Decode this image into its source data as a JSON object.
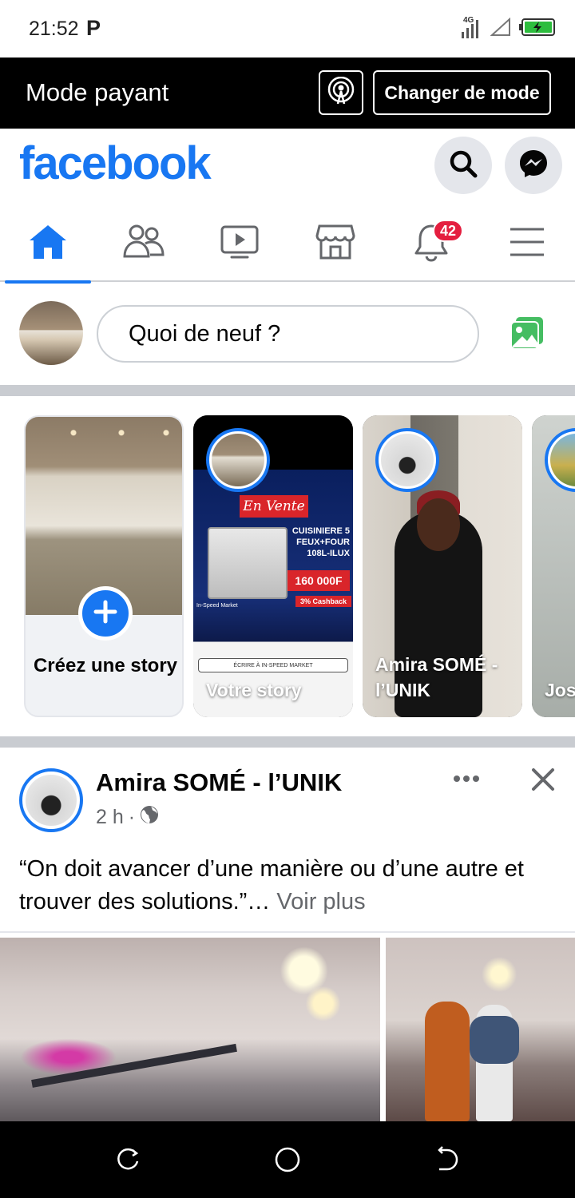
{
  "status_bar": {
    "time": "21:52",
    "carrier_glyph": "P",
    "network": "4G",
    "icons": [
      "signal-icon",
      "wifi-icon",
      "battery-charging-icon"
    ]
  },
  "mode_bar": {
    "title": "Mode payant",
    "change_mode_label": "Changer de mode",
    "icon": "broadcast-icon"
  },
  "header": {
    "logo": "facebook",
    "brand_color": "#1877f2",
    "icons": [
      "search-icon",
      "messenger-icon"
    ]
  },
  "nav": {
    "tabs": [
      {
        "name": "home",
        "icon": "home-icon",
        "active": true
      },
      {
        "name": "friends",
        "icon": "friends-icon",
        "active": false
      },
      {
        "name": "watch",
        "icon": "video-icon",
        "active": false
      },
      {
        "name": "marketplace",
        "icon": "marketplace-icon",
        "active": false
      },
      {
        "name": "notifications",
        "icon": "bell-icon",
        "active": false,
        "badge": "42"
      },
      {
        "name": "menu",
        "icon": "menu-icon",
        "active": false
      }
    ]
  },
  "composer": {
    "placeholder": "Quoi de neuf ?",
    "photo_icon": "photo-icon"
  },
  "stories": {
    "create_label": "Créez une story",
    "items": [
      {
        "label": "Votre story"
      },
      {
        "label": "Amira SOMÉ - l’UNIK"
      },
      {
        "label": "Jos"
      }
    ],
    "ad": {
      "headline": "En Vente",
      "product": "CUISINIERE 5 FEUX+FOUR 108L-ILUX",
      "price": "160 000F",
      "cashback": "3% Cashback",
      "seller": "In-Speed Market",
      "cta": "ÉCRIRE À IN-SPEED MARKET"
    }
  },
  "post": {
    "author": "Amira SOMÉ - l’UNIK",
    "time": "2 h",
    "separator": "·",
    "privacy_icon": "globe-icon",
    "text": "“On doit avancer d’une manière ou d’une autre et trouver des solutions.”…",
    "see_more": "Voir plus"
  },
  "android_nav": {
    "icons": [
      "recent-apps-icon",
      "home-circle-icon",
      "back-icon"
    ]
  }
}
